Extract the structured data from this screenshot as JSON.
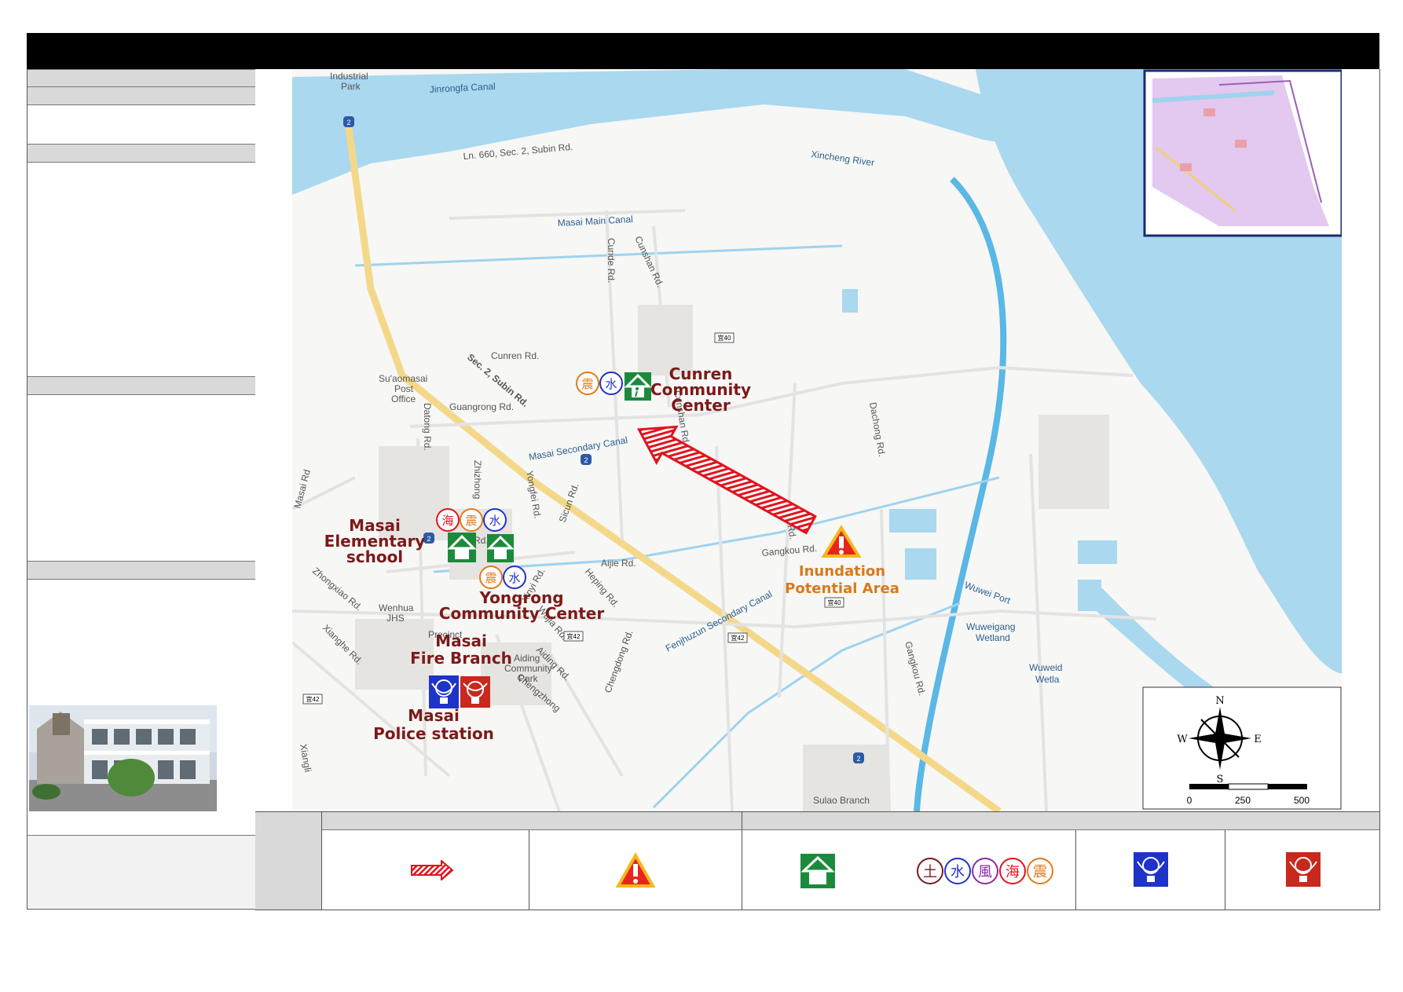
{
  "title": "",
  "map": {
    "roads": {
      "sec2_subin": "Sec. 2, Subin Rd.",
      "ln660": "Ln. 660, Sec. 2, Subin Rd.",
      "cunren": "Cunren Rd.",
      "guangrong": "Guangrong Rd.",
      "datong": "Datong Rd.",
      "masai": "Masai Rd",
      "cunde": "Cunde Rd.",
      "cunshan": "Cunshan Rd.",
      "cunshan2": "Cunshan Rd.",
      "aijie": "Aijie Rd.",
      "aijie2": "Aijie Rd.",
      "gangkou": "Gangkou Rd.",
      "gangkou2": "Gangkou Rd.",
      "dachong": "Dachong Rd.",
      "daye": "Daye Rd.",
      "heping": "Heping Rd.",
      "xinyi": "Xinyi Rd.",
      "wujia": "Wujia Rd.",
      "aiding": "Aiding Rd.",
      "zhongxiao": "Zhongxiao Rd.",
      "xianghe": "Xianghe Rd.",
      "chengdong": "Chengdong Rd.",
      "chengzhong": "Chengzhong",
      "yongfei": "Yongfei Rd.",
      "sicun": "Sicun Rd.",
      "zhizhong": "Zhizhong",
      "xiangli": "Xiangli"
    },
    "water": {
      "jinrongfa": "Jinrongfa Canal",
      "xincheng": "Xincheng River",
      "masai_main": "Masai Main Canal",
      "masai_secondary": "Masai Secondary Canal",
      "fenjhuzun": "Fenjhuzun Secondary Canal",
      "wuwei_port": "Wuwei Port",
      "wuweigang_wetland_1": "Wuweigang",
      "wuweigang_wetland_2": "Wetland",
      "wuweigang_partial_1": "Wuweid",
      "wuweigang_partial_2": "Wetla"
    },
    "pois": {
      "post_1": "Su'aomasai",
      "post_2": "Post",
      "post_3": "Office",
      "park_1": "Aiding",
      "park_2": "Community",
      "park_3": "Park",
      "industrial_1": "Industrial",
      "industrial_2": "Park",
      "wenhua_1": "Wenhua",
      "wenhua_2": "JHS",
      "es": "ES",
      "sulao": "Sulao Branch",
      "precinct": "Precinct"
    },
    "shields": {
      "hwy2": "2",
      "r40": "宜40",
      "r42": "宜42"
    },
    "facilities": {
      "cunren": [
        "Cunren",
        "Community",
        "Center"
      ],
      "masai_es": [
        "Masai",
        "Elementary",
        "school"
      ],
      "yongrong": [
        "Yongrong",
        "Community Center"
      ],
      "fire": [
        "Masai",
        "Fire Branch"
      ],
      "police": [
        "Masai",
        "Police station"
      ],
      "inundation": [
        "Inundation",
        "Potential Area"
      ]
    },
    "glyphs": {
      "sea": "海",
      "quake": "震",
      "water": "水",
      "earth": "土",
      "wind": "風"
    },
    "compass": {
      "n": "N",
      "s": "S",
      "e": "E",
      "w": "W"
    },
    "scale": {
      "t0": "0",
      "t1": "250",
      "t2": "500"
    }
  },
  "colors": {
    "water": "#a9d8ef",
    "river_blue": "#5ab7e6",
    "label_dark_red": "#7b1a1a",
    "inundation_orange": "#d9791a",
    "shelter_green": "#1c8a3c",
    "police_blue": "#1e33c8",
    "fire_red": "#c8281e"
  },
  "legend": {
    "icons": [
      "evacuation-arrow-icon",
      "warning-icon",
      "shelter-icon",
      "hazard-type-icons",
      "police-badge-icon",
      "fire-badge-icon"
    ]
  }
}
